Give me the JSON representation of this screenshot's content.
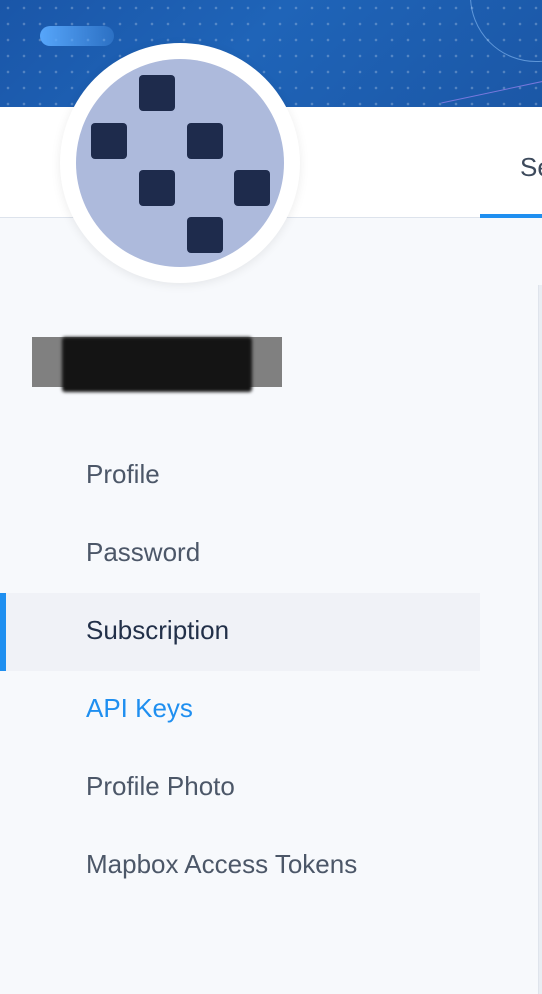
{
  "tabs": {
    "settings_label": "Se"
  },
  "user": {
    "name_redacted": true
  },
  "sidebar": {
    "items": [
      {
        "label": "Profile",
        "state": "default"
      },
      {
        "label": "Password",
        "state": "default"
      },
      {
        "label": "Subscription",
        "state": "active"
      },
      {
        "label": "API Keys",
        "state": "link"
      },
      {
        "label": "Profile Photo",
        "state": "default"
      },
      {
        "label": "Mapbox Access Tokens",
        "state": "default"
      }
    ]
  },
  "colors": {
    "accent": "#1f8ff0",
    "banner": "#1b5fb5",
    "avatar_bg": "#adbadc",
    "avatar_blocks": "#1e2b4c"
  }
}
